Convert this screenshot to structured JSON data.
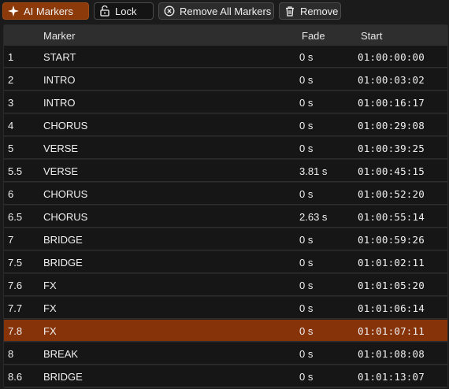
{
  "toolbar": {
    "ai_markers_label": "AI Markers",
    "lock_label": "Lock",
    "remove_all_label": "Remove All Markers",
    "remove_label": "Remove"
  },
  "table": {
    "columns": {
      "marker": "Marker",
      "fade": "Fade",
      "start": "Start"
    },
    "rows": [
      {
        "num": "1",
        "marker": "START",
        "fade": "0 s",
        "start": "01:00:00:00"
      },
      {
        "num": "2",
        "marker": "INTRO",
        "fade": "0 s",
        "start": "01:00:03:02"
      },
      {
        "num": "3",
        "marker": "INTRO",
        "fade": "0 s",
        "start": "01:00:16:17"
      },
      {
        "num": "4",
        "marker": "CHORUS",
        "fade": "0 s",
        "start": "01:00:29:08"
      },
      {
        "num": "5",
        "marker": "VERSE",
        "fade": "0 s",
        "start": "01:00:39:25"
      },
      {
        "num": "5.5",
        "marker": "VERSE",
        "fade": "3.81 s",
        "start": "01:00:45:15"
      },
      {
        "num": "6",
        "marker": "CHORUS",
        "fade": "0 s",
        "start": "01:00:52:20"
      },
      {
        "num": "6.5",
        "marker": "CHORUS",
        "fade": "2.63 s",
        "start": "01:00:55:14"
      },
      {
        "num": "7",
        "marker": "BRIDGE",
        "fade": "0 s",
        "start": "01:00:59:26"
      },
      {
        "num": "7.5",
        "marker": "BRIDGE",
        "fade": "0 s",
        "start": "01:01:02:11"
      },
      {
        "num": "7.6",
        "marker": "FX",
        "fade": "0 s",
        "start": "01:01:05:20"
      },
      {
        "num": "7.7",
        "marker": "FX",
        "fade": "0 s",
        "start": "01:01:06:14"
      },
      {
        "num": "7.8",
        "marker": "FX",
        "fade": "0 s",
        "start": "01:01:07:11"
      },
      {
        "num": "8",
        "marker": "BREAK",
        "fade": "0 s",
        "start": "01:01:08:08"
      },
      {
        "num": "8.6",
        "marker": "BRIDGE",
        "fade": "0 s",
        "start": "01:01:13:07"
      }
    ],
    "selected_row": "7.8"
  },
  "colors": {
    "accent": "#8c3a0a",
    "selected_row": "#86330a",
    "background": "#1b1b1b"
  },
  "icons": [
    "sparkle-icon",
    "lock-open-icon",
    "circle-x-icon",
    "trash-icon"
  ]
}
